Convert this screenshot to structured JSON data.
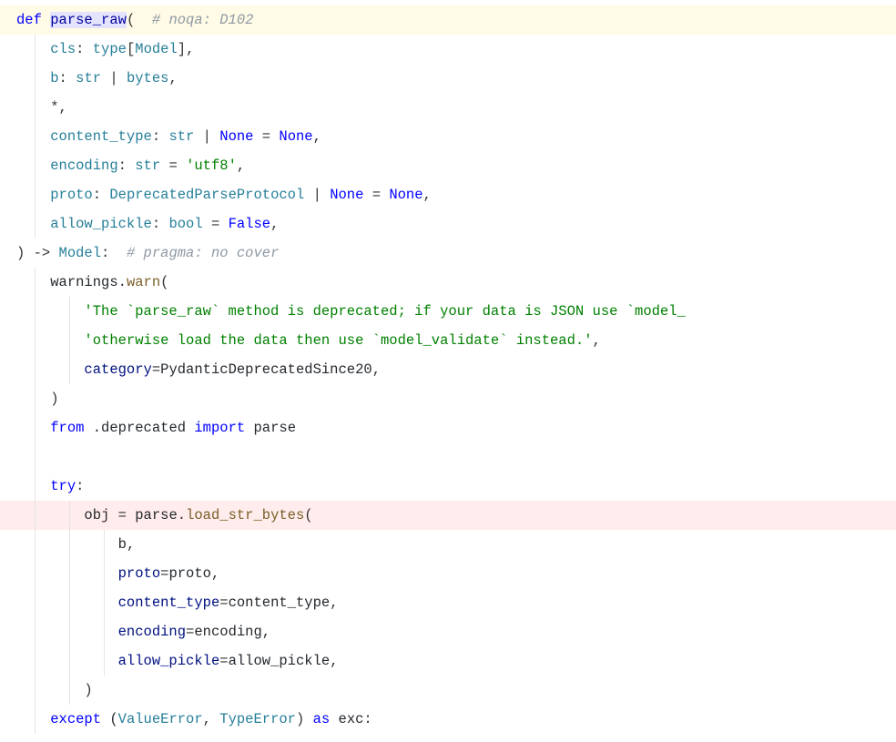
{
  "code": {
    "lines": [
      {
        "hl": "def",
        "guides": [],
        "tokens": [
          {
            "cls": "kw",
            "t": "def "
          },
          {
            "cls": "funcname-def",
            "t": "parse_raw"
          },
          {
            "cls": "punct",
            "t": "(  "
          },
          {
            "cls": "comment",
            "t": "# noqa: D102"
          }
        ]
      },
      {
        "hl": null,
        "guides": [
          1
        ],
        "tokens": [
          {
            "cls": "",
            "t": "    "
          },
          {
            "cls": "paramname",
            "t": "cls"
          },
          {
            "cls": "punct",
            "t": ": "
          },
          {
            "cls": "typeann",
            "t": "type"
          },
          {
            "cls": "punct",
            "t": "["
          },
          {
            "cls": "typeann",
            "t": "Model"
          },
          {
            "cls": "punct",
            "t": "],"
          }
        ]
      },
      {
        "hl": null,
        "guides": [
          1
        ],
        "tokens": [
          {
            "cls": "",
            "t": "    "
          },
          {
            "cls": "paramname",
            "t": "b"
          },
          {
            "cls": "punct",
            "t": ": "
          },
          {
            "cls": "typeann",
            "t": "str"
          },
          {
            "cls": "punct",
            "t": " | "
          },
          {
            "cls": "typeann",
            "t": "bytes"
          },
          {
            "cls": "punct",
            "t": ","
          }
        ]
      },
      {
        "hl": null,
        "guides": [
          1
        ],
        "tokens": [
          {
            "cls": "",
            "t": "    "
          },
          {
            "cls": "punct",
            "t": "*,"
          }
        ]
      },
      {
        "hl": null,
        "guides": [
          1
        ],
        "tokens": [
          {
            "cls": "",
            "t": "    "
          },
          {
            "cls": "paramname",
            "t": "content_type"
          },
          {
            "cls": "punct",
            "t": ": "
          },
          {
            "cls": "typeann",
            "t": "str"
          },
          {
            "cls": "punct",
            "t": " | "
          },
          {
            "cls": "const",
            "t": "None"
          },
          {
            "cls": "punct",
            "t": " = "
          },
          {
            "cls": "const",
            "t": "None"
          },
          {
            "cls": "punct",
            "t": ","
          }
        ]
      },
      {
        "hl": null,
        "guides": [
          1
        ],
        "tokens": [
          {
            "cls": "",
            "t": "    "
          },
          {
            "cls": "paramname",
            "t": "encoding"
          },
          {
            "cls": "punct",
            "t": ": "
          },
          {
            "cls": "typeann",
            "t": "str"
          },
          {
            "cls": "punct",
            "t": " = "
          },
          {
            "cls": "str",
            "t": "'utf8'"
          },
          {
            "cls": "punct",
            "t": ","
          }
        ]
      },
      {
        "hl": null,
        "guides": [
          1
        ],
        "tokens": [
          {
            "cls": "",
            "t": "    "
          },
          {
            "cls": "paramname",
            "t": "proto"
          },
          {
            "cls": "punct",
            "t": ": "
          },
          {
            "cls": "typeann",
            "t": "DeprecatedParseProtocol"
          },
          {
            "cls": "punct",
            "t": " | "
          },
          {
            "cls": "const",
            "t": "None"
          },
          {
            "cls": "punct",
            "t": " = "
          },
          {
            "cls": "const",
            "t": "None"
          },
          {
            "cls": "punct",
            "t": ","
          }
        ]
      },
      {
        "hl": null,
        "guides": [
          1
        ],
        "tokens": [
          {
            "cls": "",
            "t": "    "
          },
          {
            "cls": "paramname",
            "t": "allow_pickle"
          },
          {
            "cls": "punct",
            "t": ": "
          },
          {
            "cls": "typeann",
            "t": "bool"
          },
          {
            "cls": "punct",
            "t": " = "
          },
          {
            "cls": "bool",
            "t": "False"
          },
          {
            "cls": "punct",
            "t": ","
          }
        ]
      },
      {
        "hl": null,
        "guides": [],
        "tokens": [
          {
            "cls": "punct",
            "t": ") -> "
          },
          {
            "cls": "typeann",
            "t": "Model"
          },
          {
            "cls": "punct",
            "t": ":  "
          },
          {
            "cls": "comment",
            "t": "# pragma: no cover"
          }
        ]
      },
      {
        "hl": null,
        "guides": [
          1
        ],
        "tokens": [
          {
            "cls": "",
            "t": "    "
          },
          {
            "cls": "id",
            "t": "warnings"
          },
          {
            "cls": "punct",
            "t": "."
          },
          {
            "cls": "member",
            "t": "warn"
          },
          {
            "cls": "punct",
            "t": "("
          }
        ]
      },
      {
        "hl": null,
        "guides": [
          1,
          2
        ],
        "tokens": [
          {
            "cls": "",
            "t": "        "
          },
          {
            "cls": "str",
            "t": "'The `parse_raw` method is deprecated; if your data is JSON use `model_"
          }
        ]
      },
      {
        "hl": null,
        "guides": [
          1,
          2
        ],
        "tokens": [
          {
            "cls": "",
            "t": "        "
          },
          {
            "cls": "str",
            "t": "'otherwise load the data then use `model_validate` instead.'"
          },
          {
            "cls": "punct",
            "t": ","
          }
        ]
      },
      {
        "hl": null,
        "guides": [
          1,
          2
        ],
        "tokens": [
          {
            "cls": "",
            "t": "        "
          },
          {
            "cls": "kwarg",
            "t": "category"
          },
          {
            "cls": "punct",
            "t": "="
          },
          {
            "cls": "id",
            "t": "PydanticDeprecatedSince20"
          },
          {
            "cls": "punct",
            "t": ","
          }
        ]
      },
      {
        "hl": null,
        "guides": [
          1
        ],
        "tokens": [
          {
            "cls": "",
            "t": "    "
          },
          {
            "cls": "punct",
            "t": ")"
          }
        ]
      },
      {
        "hl": null,
        "guides": [
          1
        ],
        "tokens": [
          {
            "cls": "",
            "t": "    "
          },
          {
            "cls": "kw",
            "t": "from"
          },
          {
            "cls": "",
            "t": " ."
          },
          {
            "cls": "id",
            "t": "deprecated"
          },
          {
            "cls": "",
            "t": " "
          },
          {
            "cls": "kw",
            "t": "import"
          },
          {
            "cls": "",
            "t": " "
          },
          {
            "cls": "id",
            "t": "parse"
          }
        ]
      },
      {
        "hl": null,
        "guides": [
          1
        ],
        "tokens": []
      },
      {
        "hl": null,
        "guides": [
          1
        ],
        "tokens": [
          {
            "cls": "",
            "t": "    "
          },
          {
            "cls": "kw",
            "t": "try"
          },
          {
            "cls": "punct",
            "t": ":"
          }
        ]
      },
      {
        "hl": "err",
        "guides": [
          1,
          2
        ],
        "tokens": [
          {
            "cls": "",
            "t": "        "
          },
          {
            "cls": "id",
            "t": "obj"
          },
          {
            "cls": "punct",
            "t": " = "
          },
          {
            "cls": "id",
            "t": "parse"
          },
          {
            "cls": "punct",
            "t": "."
          },
          {
            "cls": "member",
            "t": "load_str_bytes"
          },
          {
            "cls": "punct",
            "t": "("
          }
        ]
      },
      {
        "hl": null,
        "guides": [
          1,
          2,
          3
        ],
        "tokens": [
          {
            "cls": "",
            "t": "            "
          },
          {
            "cls": "id",
            "t": "b"
          },
          {
            "cls": "punct",
            "t": ","
          }
        ]
      },
      {
        "hl": null,
        "guides": [
          1,
          2,
          3
        ],
        "tokens": [
          {
            "cls": "",
            "t": "            "
          },
          {
            "cls": "kwarg",
            "t": "proto"
          },
          {
            "cls": "punct",
            "t": "="
          },
          {
            "cls": "id",
            "t": "proto"
          },
          {
            "cls": "punct",
            "t": ","
          }
        ]
      },
      {
        "hl": null,
        "guides": [
          1,
          2,
          3
        ],
        "tokens": [
          {
            "cls": "",
            "t": "            "
          },
          {
            "cls": "kwarg",
            "t": "content_type"
          },
          {
            "cls": "punct",
            "t": "="
          },
          {
            "cls": "id",
            "t": "content_type"
          },
          {
            "cls": "punct",
            "t": ","
          }
        ]
      },
      {
        "hl": null,
        "guides": [
          1,
          2,
          3
        ],
        "tokens": [
          {
            "cls": "",
            "t": "            "
          },
          {
            "cls": "kwarg",
            "t": "encoding"
          },
          {
            "cls": "punct",
            "t": "="
          },
          {
            "cls": "id",
            "t": "encoding"
          },
          {
            "cls": "punct",
            "t": ","
          }
        ]
      },
      {
        "hl": null,
        "guides": [
          1,
          2,
          3
        ],
        "tokens": [
          {
            "cls": "",
            "t": "            "
          },
          {
            "cls": "kwarg",
            "t": "allow_pickle"
          },
          {
            "cls": "punct",
            "t": "="
          },
          {
            "cls": "id",
            "t": "allow_pickle"
          },
          {
            "cls": "punct",
            "t": ","
          }
        ]
      },
      {
        "hl": null,
        "guides": [
          1,
          2
        ],
        "tokens": [
          {
            "cls": "",
            "t": "        "
          },
          {
            "cls": "punct",
            "t": ")"
          }
        ]
      },
      {
        "hl": null,
        "guides": [
          1
        ],
        "tokens": [
          {
            "cls": "",
            "t": "    "
          },
          {
            "cls": "kw",
            "t": "except"
          },
          {
            "cls": "",
            "t": " ("
          },
          {
            "cls": "typeann",
            "t": "ValueError"
          },
          {
            "cls": "punct",
            "t": ", "
          },
          {
            "cls": "typeann",
            "t": "TypeError"
          },
          {
            "cls": "punct",
            "t": ") "
          },
          {
            "cls": "kw",
            "t": "as"
          },
          {
            "cls": "",
            "t": " "
          },
          {
            "cls": "id",
            "t": "exc"
          },
          {
            "cls": "punct",
            "t": ":"
          }
        ]
      }
    ]
  }
}
